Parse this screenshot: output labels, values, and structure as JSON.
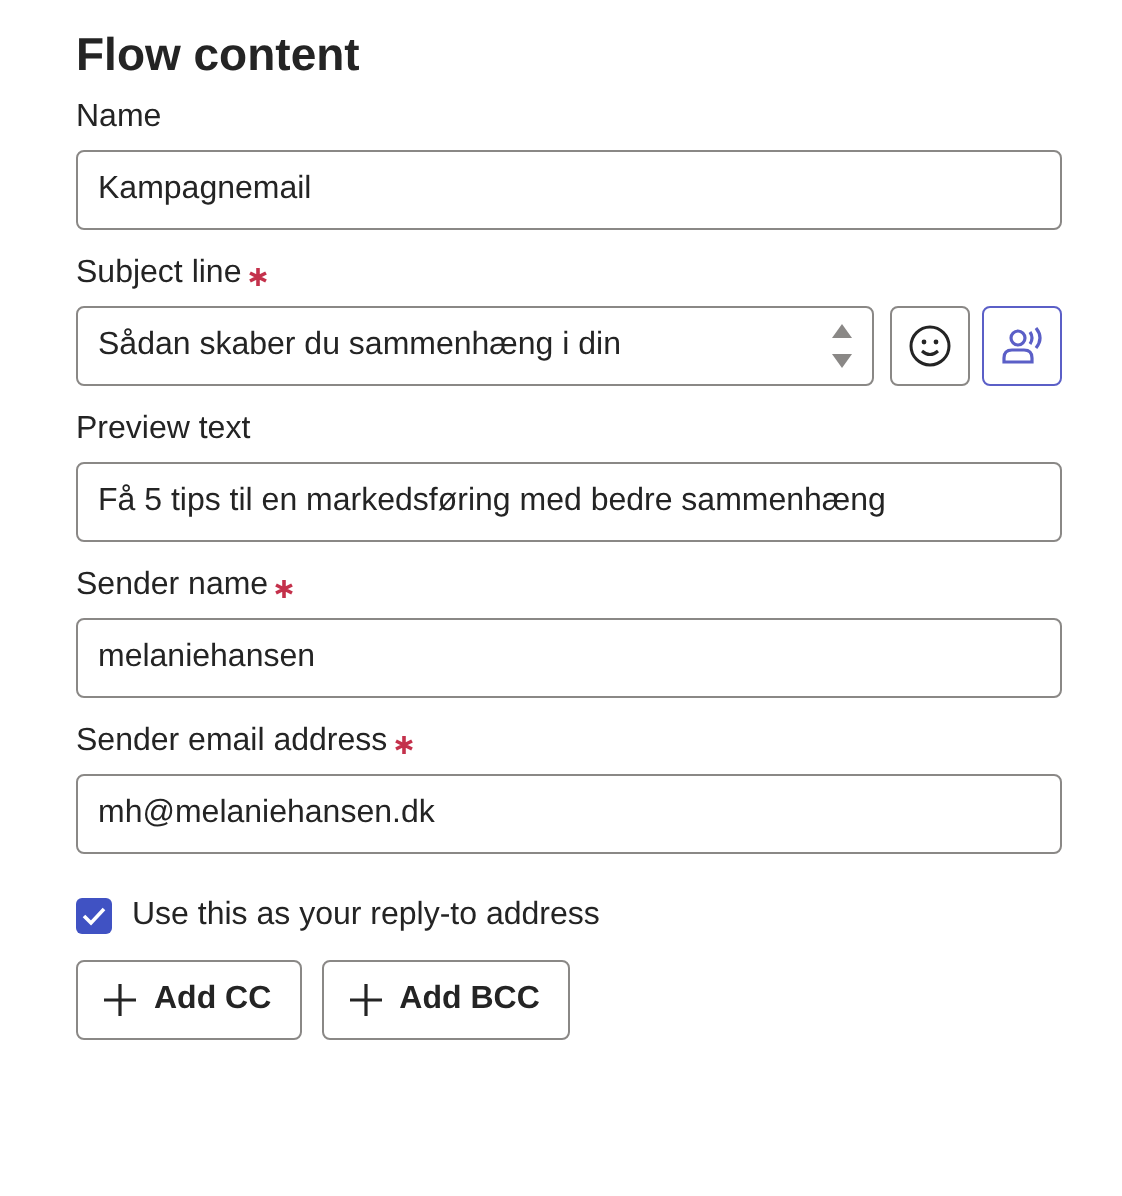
{
  "title": "Flow content",
  "fields": [
    {
      "kind": "text",
      "label": "Name",
      "required": false,
      "value": "Kampagnemail"
    },
    {
      "kind": "subject",
      "label": "Subject line",
      "required": true,
      "value": "Sådan skaber du sammenhæng i din"
    },
    {
      "kind": "text",
      "label": "Preview text",
      "required": false,
      "value": "Få 5 tips til en markedsføring med bedre sammenhæng"
    },
    {
      "kind": "text",
      "label": "Sender name",
      "required": true,
      "value": "melaniehansen"
    },
    {
      "kind": "text",
      "label": "Sender email address",
      "required": true,
      "value": "mh@melaniehansen.dk"
    }
  ],
  "reply_to": {
    "label": "Use this as your reply-to address",
    "checked": true
  },
  "buttons": [
    "Add CC",
    "Add BCC"
  ]
}
